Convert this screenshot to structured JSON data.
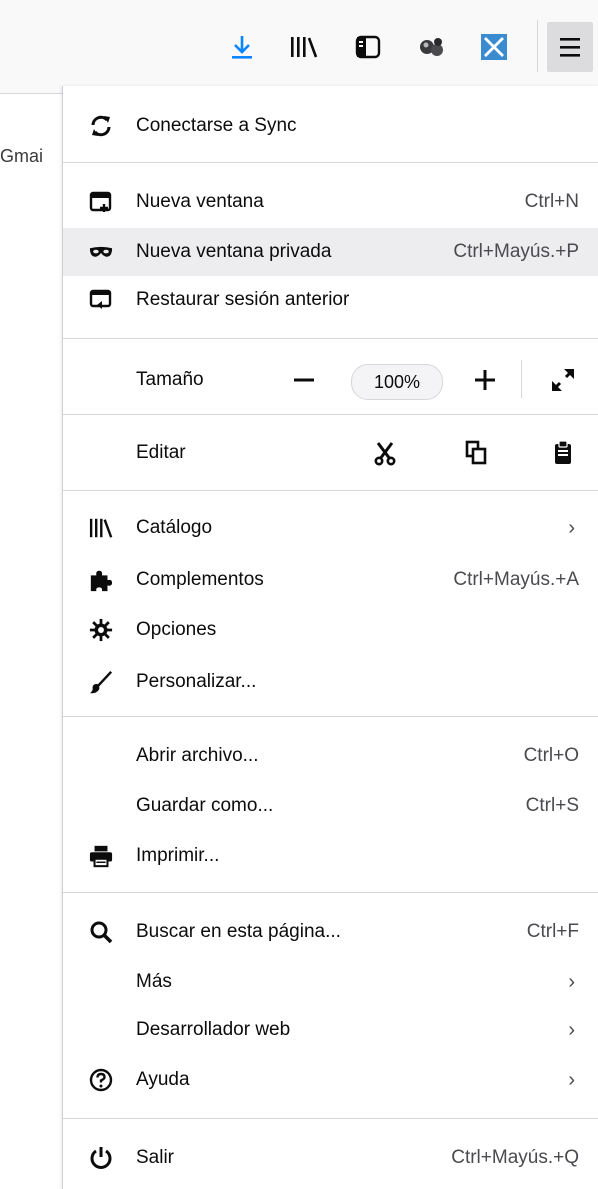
{
  "toolbar": {
    "buttons": [
      {
        "name": "downloads-icon"
      },
      {
        "name": "library-icon"
      },
      {
        "name": "sidebar-icon"
      },
      {
        "name": "extension-icon"
      },
      {
        "name": "shield-extension-icon"
      },
      {
        "name": "hamburger-menu-icon"
      }
    ]
  },
  "page": {
    "partial_text": "Gmai"
  },
  "menu": {
    "sync": "Conectarse a Sync",
    "new_window": {
      "label": "Nueva ventana",
      "shortcut": "Ctrl+N"
    },
    "private_window": {
      "label": "Nueva ventana privada",
      "shortcut": "Ctrl+Mayús.+P"
    },
    "restore": "Restaurar sesión anterior",
    "zoom": {
      "label": "Tamaño",
      "value": "100%"
    },
    "edit": {
      "label": "Editar"
    },
    "library": "Catálogo",
    "addons": {
      "label": "Complementos",
      "shortcut": "Ctrl+Mayús.+A"
    },
    "options": "Opciones",
    "customize": "Personalizar...",
    "open_file": {
      "label": "Abrir archivo...",
      "shortcut": "Ctrl+O"
    },
    "save_as": {
      "label": "Guardar como...",
      "shortcut": "Ctrl+S"
    },
    "print": "Imprimir...",
    "find": {
      "label": "Buscar en esta página...",
      "shortcut": "Ctrl+F"
    },
    "more": "Más",
    "web_dev": "Desarrollador web",
    "help": "Ayuda",
    "quit": {
      "label": "Salir",
      "shortcut": "Ctrl+Mayús.+Q"
    },
    "arrow": "›"
  },
  "colors": {
    "accent": "#0a84ff",
    "hover": "#ededf0",
    "separator": "#d7d7db"
  }
}
